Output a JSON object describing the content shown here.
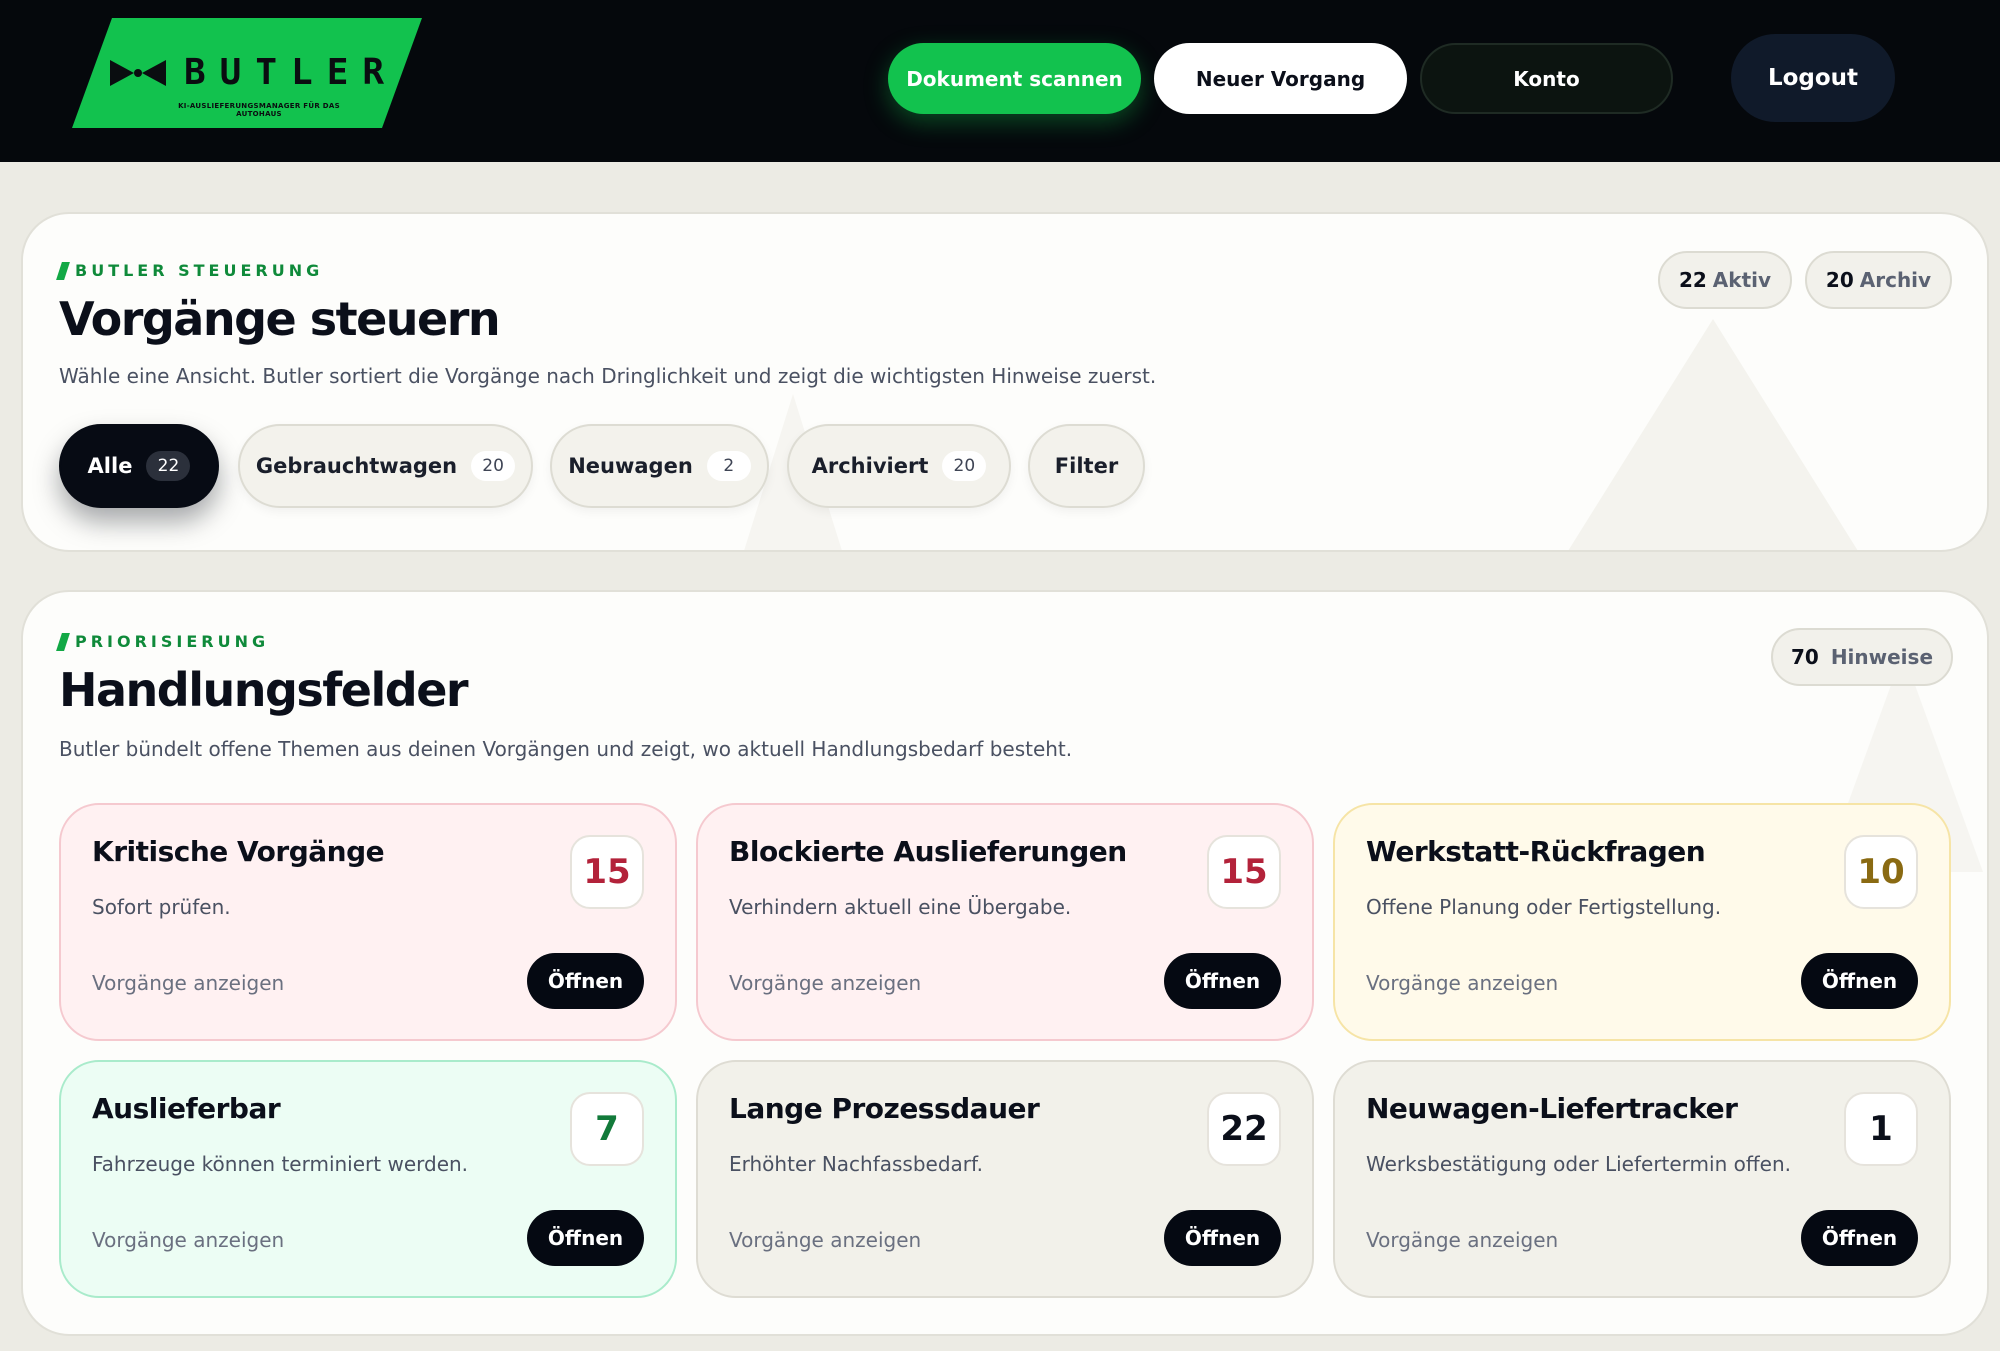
{
  "header": {
    "logo_word": "BUTLER",
    "logo_tagline": "KI-AUSLIEFERUNGSMANAGER FÜR DAS AUTOHAUS",
    "nav": {
      "scan": "Dokument scannen",
      "new": "Neuer Vorgang",
      "account": "Konto",
      "logout": "Logout"
    }
  },
  "control": {
    "eyebrow": "BUTLER STEUERUNG",
    "title": "Vorgänge steuern",
    "lead": "Wähle eine Ansicht. Butler sortiert die Vorgänge nach Dringlichkeit und zeigt die wichtigsten Hinweise zuerst.",
    "stats": {
      "active_count": "22",
      "active_label": "Aktiv",
      "archive_count": "20",
      "archive_label": "Archiv"
    },
    "filters": [
      {
        "label": "Alle",
        "count": "22"
      },
      {
        "label": "Gebrauchtwagen",
        "count": "20"
      },
      {
        "label": "Neuwagen",
        "count": "2"
      },
      {
        "label": "Archiviert",
        "count": "20"
      },
      {
        "label": "Filter"
      }
    ]
  },
  "priorities": {
    "eyebrow": "PRIORISIERUNG",
    "title": "Handlungsfelder",
    "lead": "Butler bündelt offene Themen aus deinen Vorgängen und zeigt, wo aktuell Handlungsbedarf besteht.",
    "hints_count": "70",
    "hints_label": "Hinweise",
    "link_label": "Vorgänge anzeigen",
    "open_label": "Öffnen",
    "cards": [
      {
        "title": "Kritische Vorgänge",
        "desc": "Sofort prüfen.",
        "count": "15"
      },
      {
        "title": "Blockierte Auslieferungen",
        "desc": "Verhindern aktuell eine Übergabe.",
        "count": "15"
      },
      {
        "title": "Werkstatt-Rückfragen",
        "desc": "Offene Planung oder Fertigstellung.",
        "count": "10"
      },
      {
        "title": "Auslieferbar",
        "desc": "Fahrzeuge können terminiert werden.",
        "count": "7"
      },
      {
        "title": "Lange Prozessdauer",
        "desc": "Erhöhter Nachfassbedarf.",
        "count": "22"
      },
      {
        "title": "Neuwagen-Liefertracker",
        "desc": "Werksbestätigung oder Liefertermin offen.",
        "count": "1"
      }
    ]
  },
  "colors": {
    "brand_green": "#12c24e",
    "header_bg": "#05080c",
    "critical_bg": "#fff1f2",
    "critical_border": "#f5c9cf",
    "critical_count": "#b3223a",
    "warning_bg": "#fffaea",
    "warning_border": "#f6e4a6",
    "warning_count": "#8a6a12",
    "success_bg": "#ecfdf4",
    "success_border": "#a9ebcb",
    "success_count": "#127a3a",
    "neutral_bg": "#f2f1ea",
    "neutral_border": "#dedcd3",
    "neutral_count": "#0b0f1a"
  }
}
